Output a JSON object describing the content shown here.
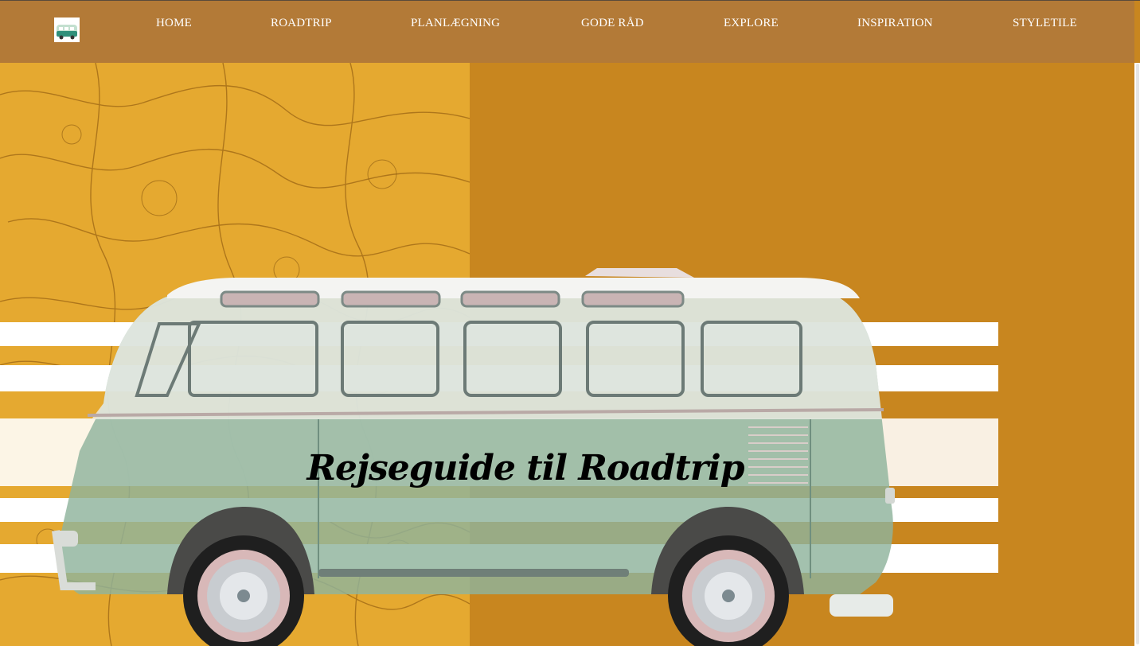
{
  "nav": {
    "logo_icon": "campervan-icon",
    "items": [
      "HOME",
      "ROADTRIP",
      "PLANLÆGNING",
      "GODE RÅD",
      "EXPLORE",
      "INSPIRATION",
      "STYLETILE"
    ]
  },
  "hero": {
    "title": "Rejseguide til Roadtrip",
    "background_image": "map-collage",
    "main_image": "vintage-campervan"
  },
  "colors": {
    "nav_bg": "#b37a37",
    "hero_bg": "#c8861f",
    "map_tint": "#e2a62e",
    "van_green": "#8fb39c",
    "text_light": "#ffffff",
    "title_text": "#000000"
  }
}
